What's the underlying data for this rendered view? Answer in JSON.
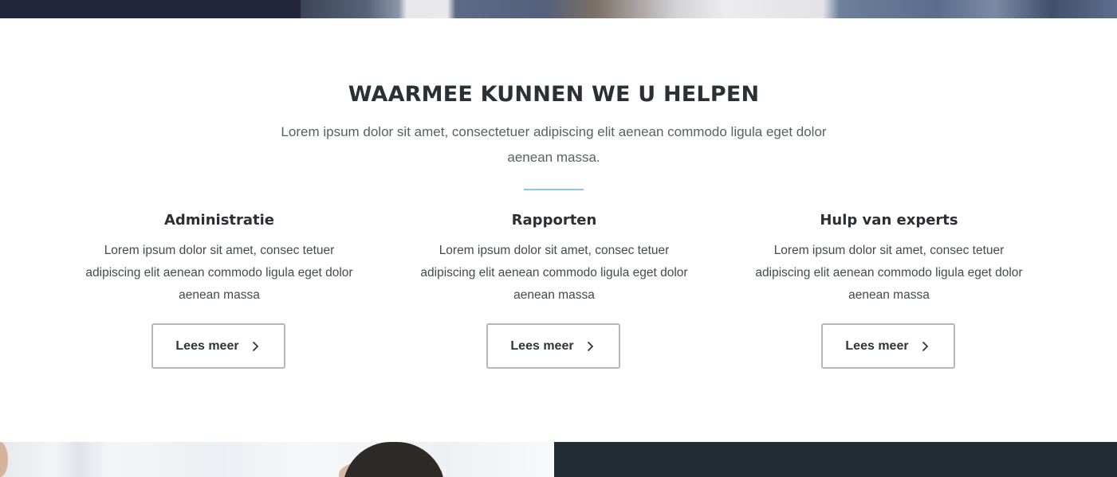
{
  "section": {
    "title": "WAARMEE KUNNEN WE U HELPEN",
    "intro": "Lorem ipsum dolor sit amet, consectetuer adipiscing elit aenean commodo ligula eget dolor aenean massa."
  },
  "services": [
    {
      "title": "Administratie",
      "text": "Lorem ipsum dolor sit amet, consec tetuer adipiscing elit aenean commodo ligula eget dolor aenean massa",
      "button_label": "Lees meer"
    },
    {
      "title": "Rapporten",
      "text": "Lorem ipsum dolor sit amet, consec tetuer adipiscing elit aenean commodo ligula eget dolor aenean massa",
      "button_label": "Lees meer"
    },
    {
      "title": "Hulp van experts",
      "text": "Lorem ipsum dolor sit amet, consec tetuer adipiscing elit aenean commodo ligula eget dolor aenean massa",
      "button_label": "Lees meer"
    }
  ],
  "icons": {
    "button_arrow": "chevron-right-icon"
  },
  "colors": {
    "accent_divider": "#8ec9dd",
    "heading": "#2b3035",
    "dark_panel": "#222c35",
    "button_border": "#b4b6ba"
  }
}
